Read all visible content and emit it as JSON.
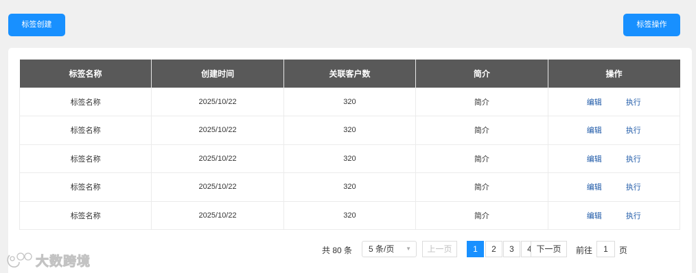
{
  "toolbar": {
    "create_label": "标签创建",
    "ops_label": "标签操作"
  },
  "table": {
    "columns": [
      "标签名称",
      "创建时间",
      "关联客户数",
      "简介",
      "操作"
    ],
    "rows": [
      {
        "name": "标签名称",
        "created": "2025/10/22",
        "count": "320",
        "intro": "简介",
        "edit": "编辑",
        "run": "执行"
      },
      {
        "name": "标签名称",
        "created": "2025/10/22",
        "count": "320",
        "intro": "简介",
        "edit": "编辑",
        "run": "执行"
      },
      {
        "name": "标签名称",
        "created": "2025/10/22",
        "count": "320",
        "intro": "简介",
        "edit": "编辑",
        "run": "执行"
      },
      {
        "name": "标签名称",
        "created": "2025/10/22",
        "count": "320",
        "intro": "简介",
        "edit": "编辑",
        "run": "执行"
      },
      {
        "name": "标签名称",
        "created": "2025/10/22",
        "count": "320",
        "intro": "简介",
        "edit": "编辑",
        "run": "执行"
      }
    ]
  },
  "pagination": {
    "total_text": "共 80 条",
    "page_size": "5 条/页",
    "prev_label": "上一页",
    "pages": [
      "1",
      "2",
      "3",
      "4"
    ],
    "current_page": "1",
    "next_label": "下一页",
    "goto_label": "前往",
    "goto_value": "1",
    "page_suffix": "页"
  },
  "watermark": {
    "text": "大数跨境",
    "icon": "brand-logo-icon"
  },
  "colors": {
    "primary": "#1890ff",
    "header_bg": "#595959",
    "link": "#1f5aa8",
    "page_bg": "#f0f0f0"
  }
}
